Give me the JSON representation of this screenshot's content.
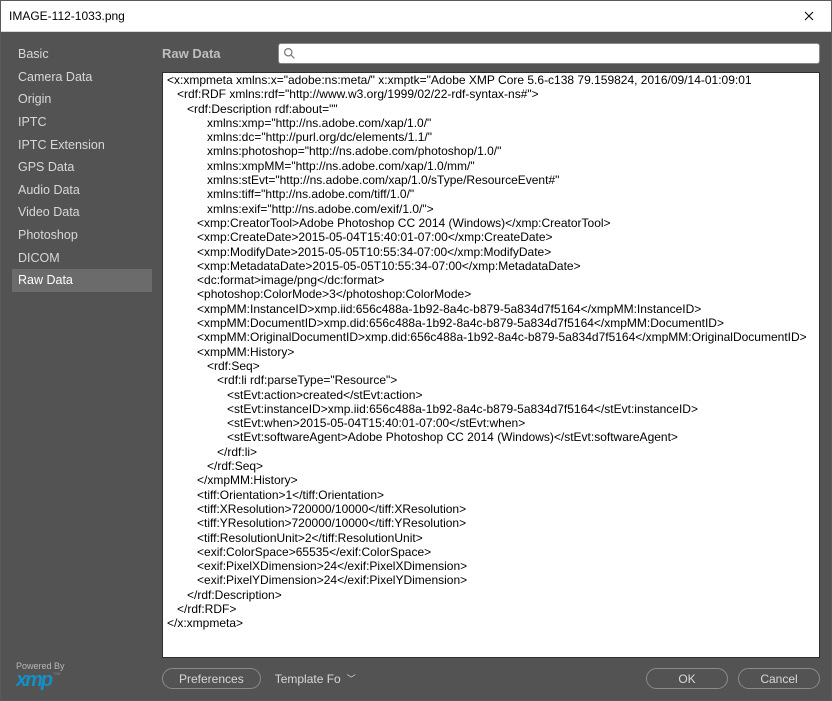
{
  "window": {
    "title": "IMAGE-112-1033.png"
  },
  "sidebar": {
    "items": [
      {
        "label": "Basic",
        "selected": false
      },
      {
        "label": "Camera Data",
        "selected": false
      },
      {
        "label": "Origin",
        "selected": false
      },
      {
        "label": "IPTC",
        "selected": false
      },
      {
        "label": "IPTC Extension",
        "selected": false
      },
      {
        "label": "GPS Data",
        "selected": false
      },
      {
        "label": "Audio Data",
        "selected": false
      },
      {
        "label": "Video Data",
        "selected": false
      },
      {
        "label": "Photoshop",
        "selected": false
      },
      {
        "label": "DICOM",
        "selected": false
      },
      {
        "label": "Raw Data",
        "selected": true
      }
    ]
  },
  "panel": {
    "title": "Raw Data",
    "search_placeholder": ""
  },
  "raw_xml": "<x:xmpmeta xmlns:x=\"adobe:ns:meta/\" x:xmptk=\"Adobe XMP Core 5.6-c138 79.159824, 2016/09/14-01:09:01\n   <rdf:RDF xmlns:rdf=\"http://www.w3.org/1999/02/22-rdf-syntax-ns#\">\n      <rdf:Description rdf:about=\"\"\n            xmlns:xmp=\"http://ns.adobe.com/xap/1.0/\"\n            xmlns:dc=\"http://purl.org/dc/elements/1.1/\"\n            xmlns:photoshop=\"http://ns.adobe.com/photoshop/1.0/\"\n            xmlns:xmpMM=\"http://ns.adobe.com/xap/1.0/mm/\"\n            xmlns:stEvt=\"http://ns.adobe.com/xap/1.0/sType/ResourceEvent#\"\n            xmlns:tiff=\"http://ns.adobe.com/tiff/1.0/\"\n            xmlns:exif=\"http://ns.adobe.com/exif/1.0/\">\n         <xmp:CreatorTool>Adobe Photoshop CC 2014 (Windows)</xmp:CreatorTool>\n         <xmp:CreateDate>2015-05-04T15:40:01-07:00</xmp:CreateDate>\n         <xmp:ModifyDate>2015-05-05T10:55:34-07:00</xmp:ModifyDate>\n         <xmp:MetadataDate>2015-05-05T10:55:34-07:00</xmp:MetadataDate>\n         <dc:format>image/png</dc:format>\n         <photoshop:ColorMode>3</photoshop:ColorMode>\n         <xmpMM:InstanceID>xmp.iid:656c488a-1b92-8a4c-b879-5a834d7f5164</xmpMM:InstanceID>\n         <xmpMM:DocumentID>xmp.did:656c488a-1b92-8a4c-b879-5a834d7f5164</xmpMM:DocumentID>\n         <xmpMM:OriginalDocumentID>xmp.did:656c488a-1b92-8a4c-b879-5a834d7f5164</xmpMM:OriginalDocumentID>\n         <xmpMM:History>\n            <rdf:Seq>\n               <rdf:li rdf:parseType=\"Resource\">\n                  <stEvt:action>created</stEvt:action>\n                  <stEvt:instanceID>xmp.iid:656c488a-1b92-8a4c-b879-5a834d7f5164</stEvt:instanceID>\n                  <stEvt:when>2015-05-04T15:40:01-07:00</stEvt:when>\n                  <stEvt:softwareAgent>Adobe Photoshop CC 2014 (Windows)</stEvt:softwareAgent>\n               </rdf:li>\n            </rdf:Seq>\n         </xmpMM:History>\n         <tiff:Orientation>1</tiff:Orientation>\n         <tiff:XResolution>720000/10000</tiff:XResolution>\n         <tiff:YResolution>720000/10000</tiff:YResolution>\n         <tiff:ResolutionUnit>2</tiff:ResolutionUnit>\n         <exif:ColorSpace>65535</exif:ColorSpace>\n         <exif:PixelXDimension>24</exif:PixelXDimension>\n         <exif:PixelYDimension>24</exif:PixelYDimension>\n      </rdf:Description>\n   </rdf:RDF>\n</x:xmpmeta>",
  "footer": {
    "preferences": "Preferences",
    "template": "Template Fo",
    "ok": "OK",
    "cancel": "Cancel"
  },
  "powered": {
    "label": "Powered By",
    "logo": "xmp"
  }
}
